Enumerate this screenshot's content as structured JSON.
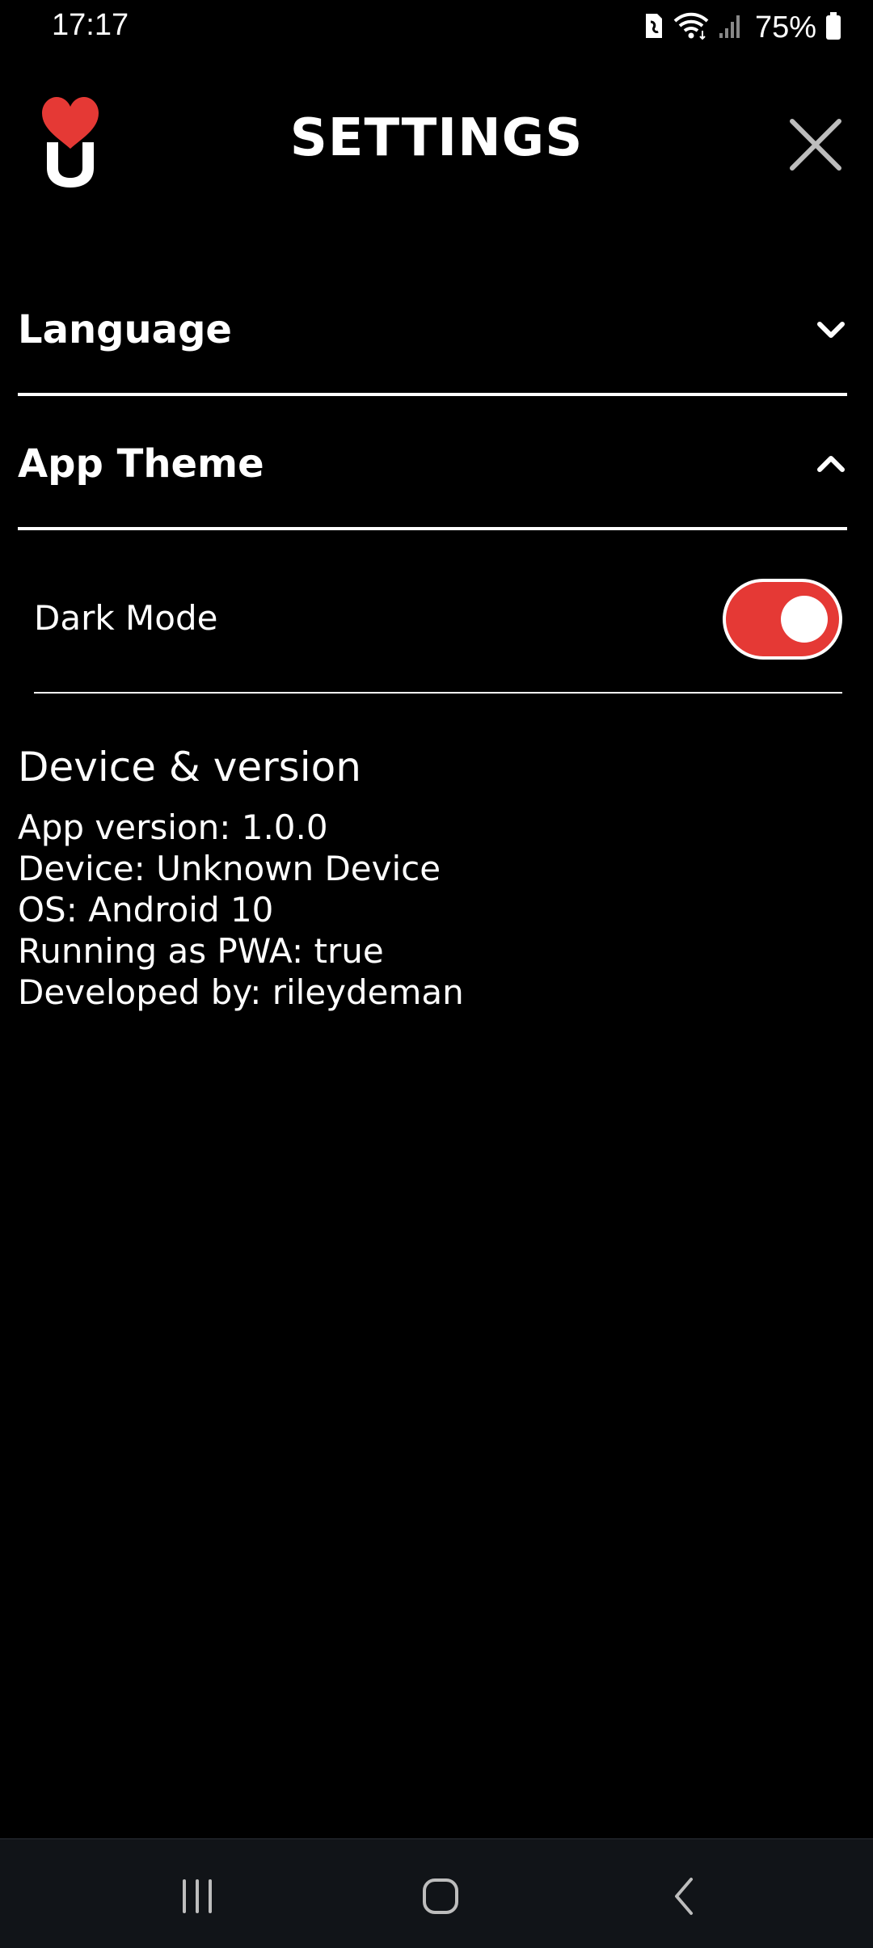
{
  "status_bar": {
    "time": "17:17",
    "battery_percent": "75%",
    "icons": [
      "sim-card-icon",
      "wifi-icon",
      "signal-icon",
      "battery-icon"
    ]
  },
  "header": {
    "title": "SETTINGS",
    "logo": "heart-u-logo",
    "close_icon": "close-icon"
  },
  "sections": {
    "language": {
      "label": "Language",
      "expanded": false,
      "icon": "chevron-down-icon"
    },
    "app_theme": {
      "label": "App Theme",
      "expanded": true,
      "icon": "chevron-up-icon",
      "dark_mode": {
        "label": "Dark Mode",
        "enabled": true
      }
    }
  },
  "device_info": {
    "heading": "Device & version",
    "lines": [
      "App version: 1.0.0",
      "Device: Unknown Device",
      "OS: Android 10",
      "Running as PWA: true",
      "Developed by: rileydeman"
    ]
  },
  "nav_bar": {
    "icons": [
      "recents-icon",
      "home-icon",
      "back-icon"
    ]
  },
  "colors": {
    "background": "#000000",
    "accent": "#e53935",
    "text": "#ffffff",
    "nav_background": "#111418"
  }
}
